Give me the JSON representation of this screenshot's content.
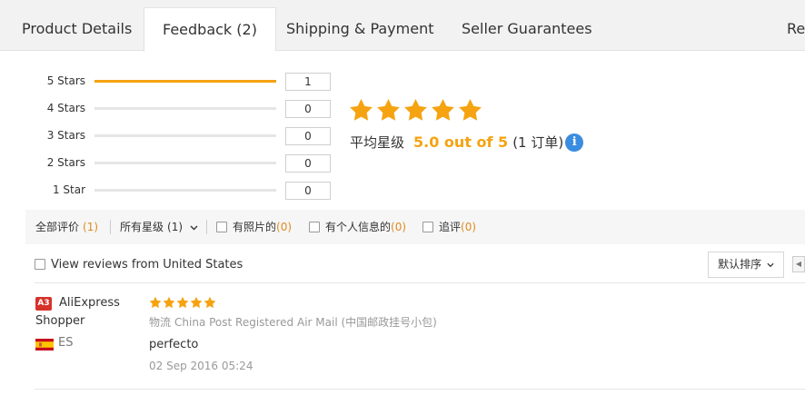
{
  "tabs": [
    {
      "label": "Product Details",
      "active": false
    },
    {
      "label": "Feedback (2)",
      "active": true
    },
    {
      "label": "Shipping & Payment",
      "active": false
    },
    {
      "label": "Seller Guarantees",
      "active": false
    },
    {
      "label": "Rep",
      "active": false
    }
  ],
  "rating_breakdown": [
    {
      "label": "5 Stars",
      "count": "1",
      "fraction": 1.0
    },
    {
      "label": "4 Stars",
      "count": "0",
      "fraction": 0
    },
    {
      "label": "3 Stars",
      "count": "0",
      "fraction": 0
    },
    {
      "label": "2 Stars",
      "count": "0",
      "fraction": 0
    },
    {
      "label": "1 Star",
      "count": "0",
      "fraction": 0
    }
  ],
  "summary": {
    "stars_filled": 5,
    "avg_label": "平均星级",
    "avg_value": "5.0 out of 5",
    "orders": "(1 订单)",
    "info_glyph": "i"
  },
  "filters": {
    "all": {
      "label": "全部评价",
      "count": "(1)"
    },
    "rating": {
      "label": "所有星级",
      "count": "(1)"
    },
    "with_photos": {
      "label": "有照片的",
      "count": "(0)"
    },
    "personal_info": {
      "label": "有个人信息的",
      "count": "(0)"
    },
    "follow_up": {
      "label": "追评",
      "count": "(0)"
    }
  },
  "view_us_label": "View reviews from United States",
  "sort": {
    "label": "默认排序"
  },
  "review": {
    "badge": "A3",
    "username_line1": "AliExpress",
    "username_line2": "Shopper",
    "country": "ES",
    "stars_filled": 5,
    "shipping_label": "物流",
    "shipping_value": "China Post Registered Air Mail (中国邮政挂号小包)",
    "text": "perfecto",
    "date": "02 Sep 2016 05:24"
  },
  "colors": {
    "accent": "#f5a311",
    "info_blue": "#3b8de0",
    "badge_red": "#d7322a"
  },
  "icons": [
    "star-icon",
    "info-icon",
    "chevron-down-icon",
    "checkbox-icon",
    "spain-flag-icon",
    "chevron-left-icon"
  ]
}
